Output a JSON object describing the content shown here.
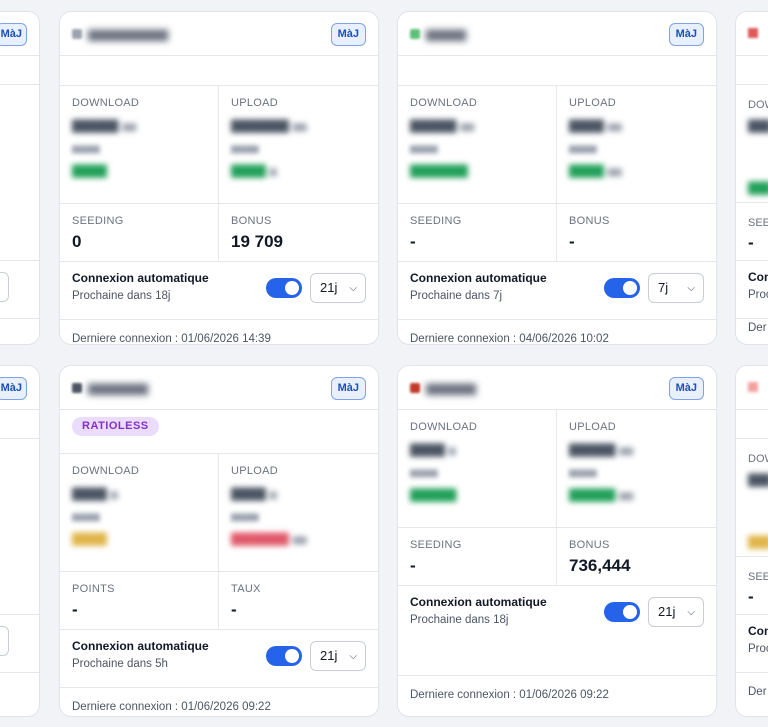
{
  "common": {
    "maj_label": "MàJ",
    "auto_title": "Connexion automatique",
    "download_label": "DOWNLOAD",
    "upload_label": "UPLOAD",
    "seeding_label": "SEEDING",
    "bonus_label": "BONUS",
    "points_label": "POINTS",
    "taux_label": "TAUX"
  },
  "cards": [
    {
      "seeding": "0",
      "bonus": "19 709",
      "next": "Prochaine dans 18j",
      "interval": "21j",
      "last": "Derniere connexion : 01/06/2026 14:39"
    },
    {
      "seeding": "-",
      "bonus": "-",
      "next": "Prochaine dans 7j",
      "interval": "7j",
      "last": "Derniere connexion : 04/06/2026 10:02"
    },
    {
      "badge": "RATIOLESS",
      "points": "-",
      "taux": "-",
      "next": "Prochaine dans 5h",
      "interval": "21j",
      "last": "Derniere connexion : 01/06/2026 09:22"
    },
    {
      "seeding": "-",
      "bonus": "736,444",
      "next": "Prochaine dans 18j",
      "interval": "21j",
      "last": "Derniere connexion : 01/06/2026 09:22"
    }
  ],
  "partial": {
    "left_label_1": "MàJ",
    "left_label_2": "MàJ",
    "right_label_dl": "DOW",
    "right_label_seed": "SEE",
    "right_label_con": "Con",
    "right_label_pro": "Proc",
    "right_label_der": "Der",
    "dash": "-"
  },
  "colors": {
    "accent": "#2563eb",
    "badge": "#8131c9",
    "border": "#dfe3ea"
  }
}
